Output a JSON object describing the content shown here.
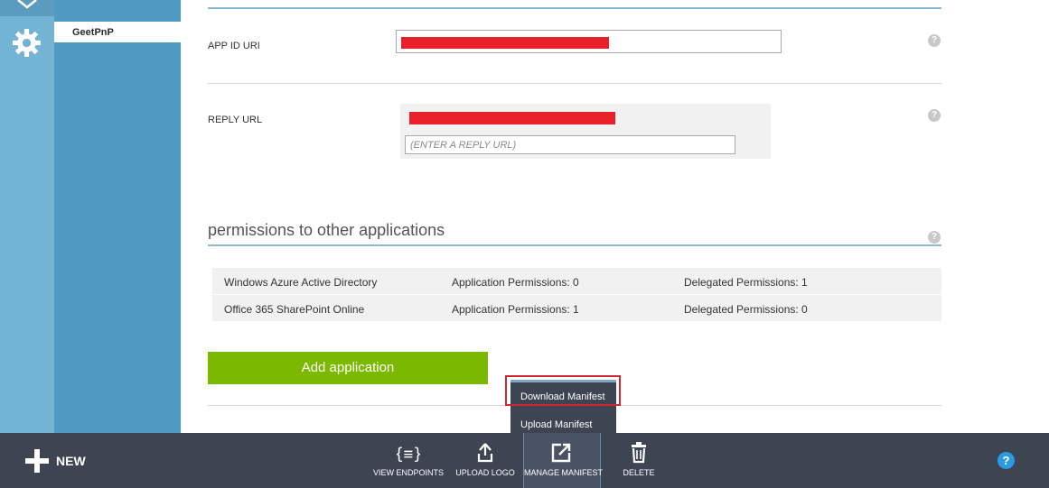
{
  "nav": {
    "app_name": "GeetPnP"
  },
  "form": {
    "app_id_uri_label": "APP ID URI",
    "reply_url_label": "REPLY URL",
    "reply_url_placeholder": "(ENTER A REPLY URL)",
    "help_glyph": "?"
  },
  "permissions": {
    "title": "permissions to other applications",
    "rows": [
      {
        "app": "Windows Azure Active Directory",
        "application": "Application Permissions: 0",
        "delegated": "Delegated Permissions: 1"
      },
      {
        "app": "Office 365 SharePoint Online",
        "application": "Application Permissions: 1",
        "delegated": "Delegated Permissions: 0"
      }
    ],
    "add_label": "Add application"
  },
  "manifest_menu": {
    "download": "Download Manifest",
    "upload": "Upload Manifest"
  },
  "commandbar": {
    "new_label": "NEW",
    "view_endpoints": "VIEW ENDPOINTS",
    "upload_logo": "UPLOAD LOGO",
    "manage_manifest": "MANAGE MANIFEST",
    "delete": "DELETE",
    "help_glyph": "?"
  },
  "colors": {
    "accent_green": "#7bb800",
    "command_bar": "#3d4452",
    "nav_blue": "#4f9ac0",
    "highlight_red": "#d0262d"
  },
  "icons": [
    "azure-logo-icon",
    "gear-icon",
    "help-icon",
    "plus-icon",
    "endpoints-icon",
    "upload-icon",
    "manage-manifest-icon",
    "trash-icon"
  ]
}
